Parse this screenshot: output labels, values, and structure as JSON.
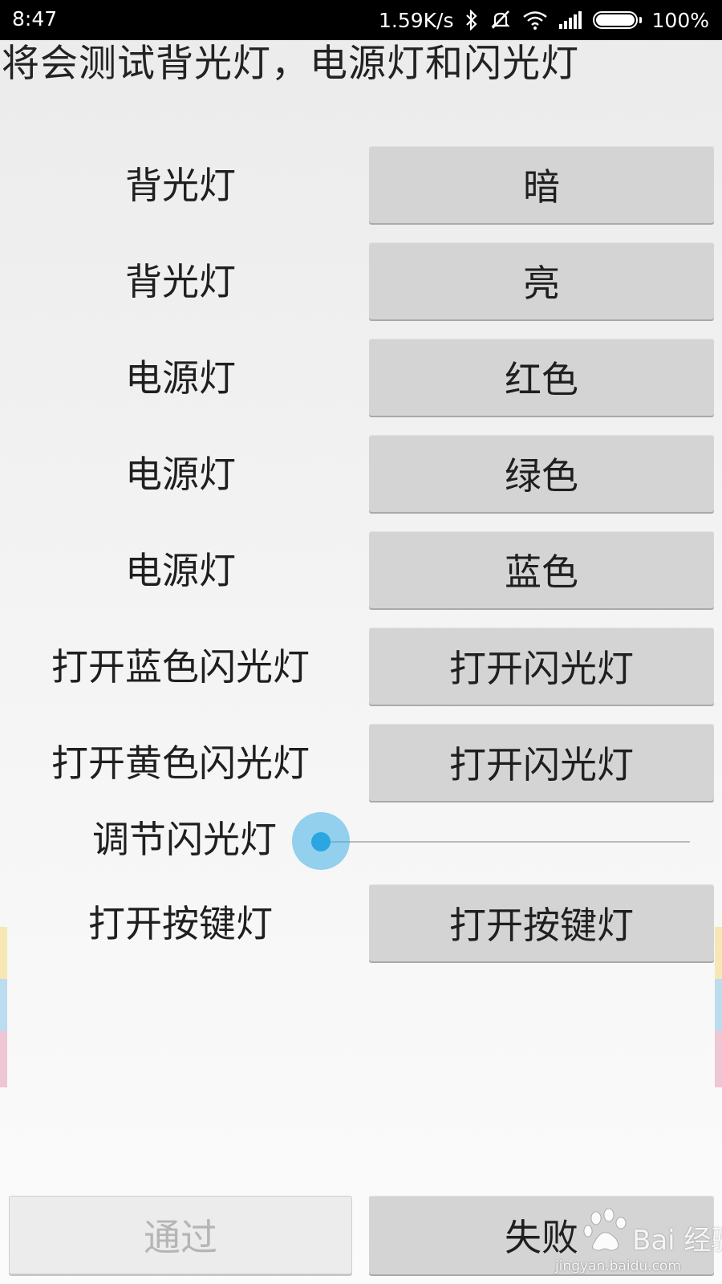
{
  "status_bar": {
    "time": "8:47",
    "network_speed": "1.59K/s",
    "battery": "100%",
    "icons": [
      "bluetooth-icon",
      "mute-icon",
      "wifi-icon",
      "signal-icon",
      "battery-icon"
    ]
  },
  "instruction": "将会测试背光灯，电源灯和闪光灯",
  "rows": [
    {
      "label": "背光灯",
      "button": "暗"
    },
    {
      "label": "背光灯",
      "button": "亮"
    },
    {
      "label": "电源灯",
      "button": "红色"
    },
    {
      "label": "电源灯",
      "button": "绿色"
    },
    {
      "label": "电源灯",
      "button": "蓝色"
    },
    {
      "label": "打开蓝色闪光灯",
      "button": "打开闪光灯"
    },
    {
      "label": "打开黄色闪光灯",
      "button": "打开闪光灯"
    }
  ],
  "slider": {
    "label": "调节闪光灯",
    "value": 0
  },
  "key_light": {
    "label": "打开按键灯",
    "button": "打开按键灯"
  },
  "footer": {
    "pass": "通过",
    "fail": "失败"
  },
  "watermark": {
    "brand": "Bai 经验",
    "url": "jingyan.baidu.com"
  },
  "colors": {
    "accent": "#2aa6e2",
    "button_bg": "#d4d4d4",
    "strip_yellow": "#f6e7b4",
    "strip_blue": "#bcdcf0",
    "strip_pink": "#efc6d4"
  }
}
